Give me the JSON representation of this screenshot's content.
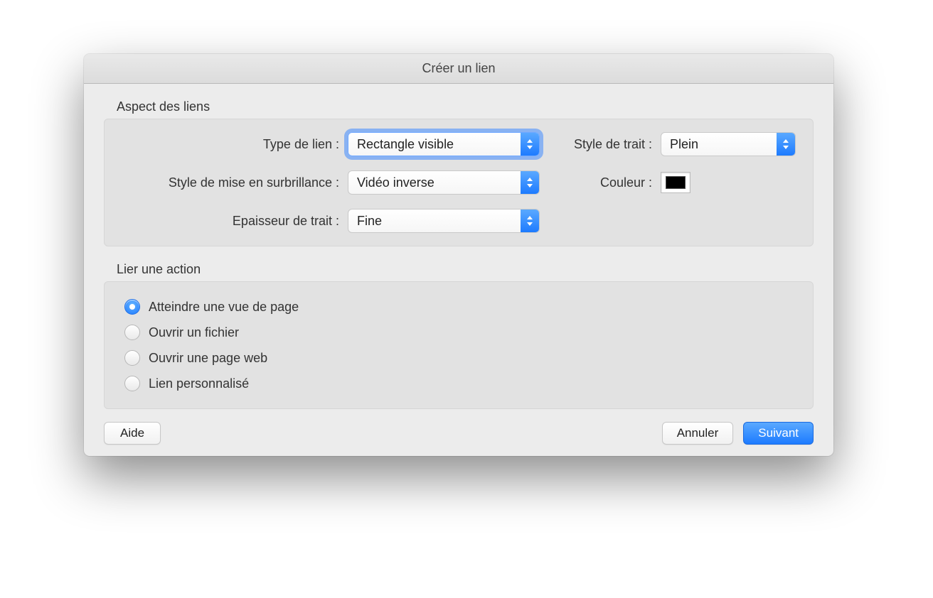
{
  "dialog": {
    "title": "Créer un lien"
  },
  "appearance": {
    "heading": "Aspect des liens",
    "link_type_label": "Type de lien :",
    "link_type_value": "Rectangle visible",
    "line_style_label": "Style de trait :",
    "line_style_value": "Plein",
    "highlight_label": "Style de mise en surbrillance :",
    "highlight_value": "Vidéo inverse",
    "color_label": "Couleur :",
    "color_value": "#000000",
    "thickness_label": "Epaisseur de trait :",
    "thickness_value": "Fine"
  },
  "action": {
    "heading": "Lier une action",
    "options": [
      {
        "label": "Atteindre une vue de page",
        "selected": true
      },
      {
        "label": "Ouvrir un fichier",
        "selected": false
      },
      {
        "label": "Ouvrir une page web",
        "selected": false
      },
      {
        "label": "Lien personnalisé",
        "selected": false
      }
    ]
  },
  "buttons": {
    "help": "Aide",
    "cancel": "Annuler",
    "next": "Suivant"
  }
}
